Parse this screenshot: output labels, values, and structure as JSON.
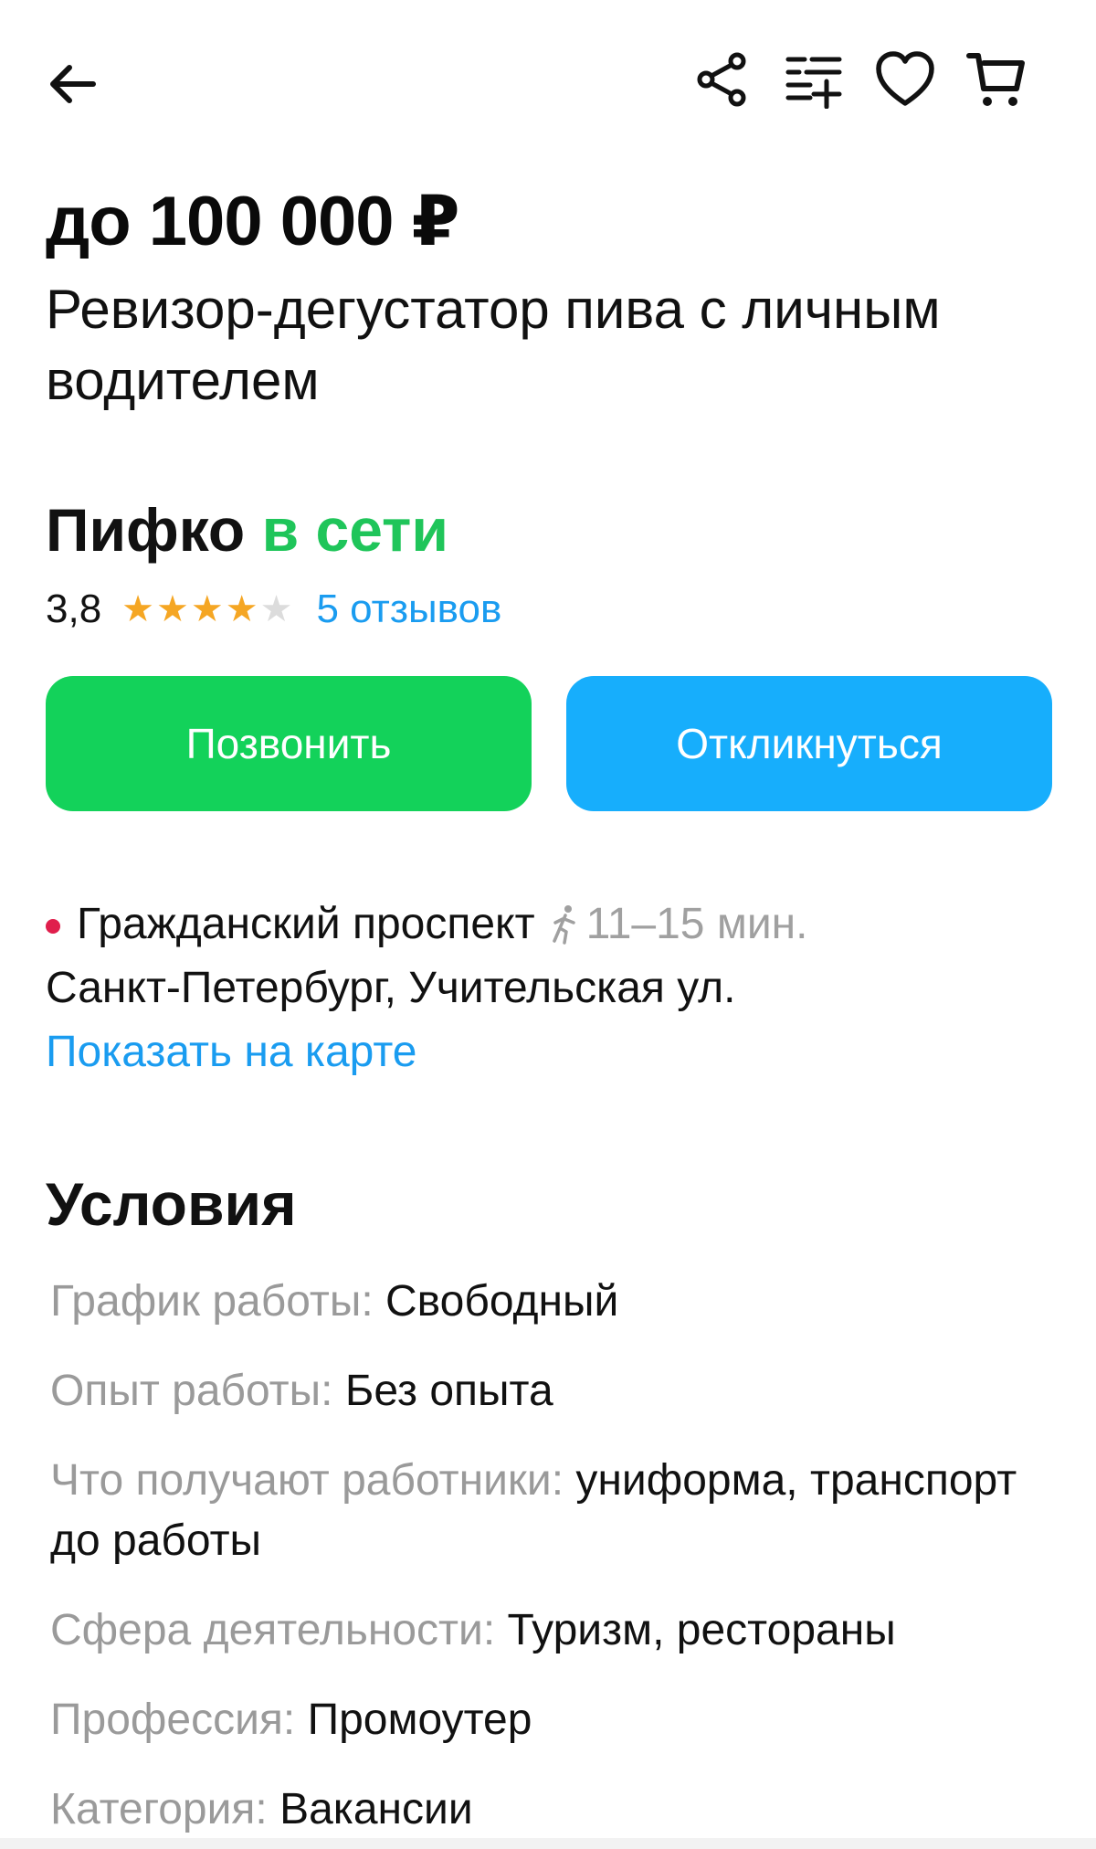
{
  "header": {
    "icons": [
      "arrow-left-icon",
      "share-icon",
      "compare-icon",
      "heart-icon",
      "cart-icon"
    ]
  },
  "listing": {
    "price": "до 100 000 ₽",
    "title": "Ревизор-дегустатор пива с личным водителем"
  },
  "seller": {
    "name": "Пифко",
    "status": "в сети",
    "rating": "3,8",
    "stars_filled": 4,
    "stars_total": 5,
    "reviews_label": "5 отзывов",
    "star_color": "#f5a623"
  },
  "actions": {
    "call_label": "Позвонить",
    "respond_label": "Откликнуться",
    "call_color": "#13d25a",
    "respond_color": "#17aefc"
  },
  "location": {
    "metro_station": "Гражданский проспект",
    "metro_line_color": "#e01e4c",
    "walk_time": "11–15 мин.",
    "address": "Санкт-Петербург, Учительская ул.",
    "map_link": "Показать на карте"
  },
  "conditions": {
    "heading": "Условия",
    "items": [
      {
        "label": "График работы:",
        "value": "Свободный"
      },
      {
        "label": "Опыт работы:",
        "value": "Без опыта"
      },
      {
        "label": "Что получают работники:",
        "value": "униформа, транспорт до работы"
      },
      {
        "label": "Сфера деятельности:",
        "value": "Туризм, рестораны"
      },
      {
        "label": "Профессия:",
        "value": "Промоутер"
      },
      {
        "label": "Категория:",
        "value": "Вакансии"
      }
    ]
  }
}
